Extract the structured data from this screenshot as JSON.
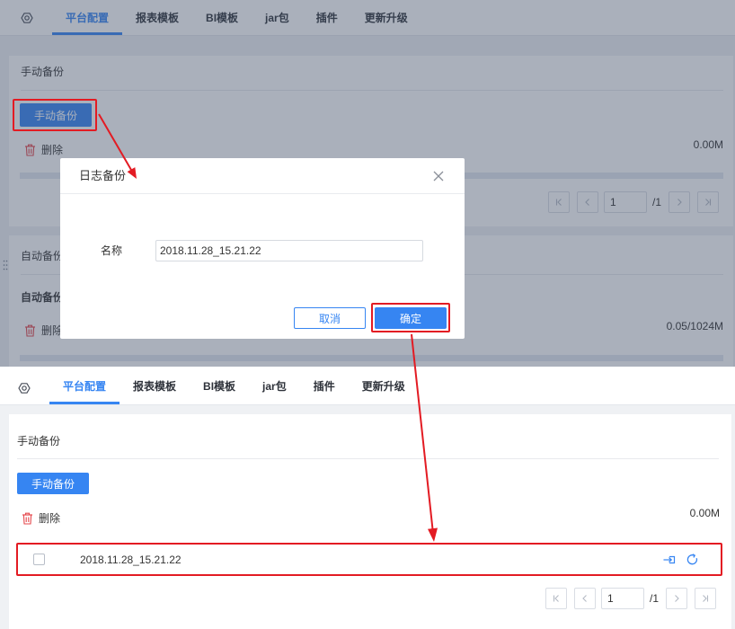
{
  "tabs": [
    {
      "label": "平台配置",
      "active": true
    },
    {
      "label": "报表模板",
      "active": false
    },
    {
      "label": "BI模板",
      "active": false
    },
    {
      "label": "jar包",
      "active": false
    },
    {
      "label": "插件",
      "active": false
    },
    {
      "label": "更新升级",
      "active": false
    }
  ],
  "before": {
    "manual_backup": {
      "section_title": "手动备份",
      "button_label": "手动备份",
      "delete_label": "删除",
      "storage_used": "0.00M",
      "rows": []
    },
    "pagination": {
      "current_page": "1",
      "total_label": "/1"
    },
    "auto_backup": {
      "section_title": "自动备份",
      "subsection_title": "自动备份",
      "delete_label": "删除",
      "storage_used": "0.05/1024M"
    }
  },
  "dialog": {
    "title": "日志备份",
    "name_label": "名称",
    "name_value": "2018.11.28_15.21.22",
    "cancel_label": "取消",
    "confirm_label": "确定"
  },
  "after": {
    "manual_backup": {
      "section_title": "手动备份",
      "button_label": "手动备份",
      "delete_label": "删除",
      "storage_used": "0.00M",
      "rows": [
        {
          "name": "2018.11.28_15.21.22",
          "checked": false
        }
      ]
    },
    "pagination": {
      "current_page": "1",
      "total_label": "/1"
    }
  },
  "icons": {
    "settings": "gear-icon",
    "delete": "trash-icon",
    "close": "close-icon",
    "first_page": "first-page-icon",
    "prev_page": "prev-page-icon",
    "next_page": "next-page-icon",
    "last_page": "last-page-icon",
    "row_restore": "restore-icon",
    "row_refresh": "refresh-icon",
    "resize": "drag-handle-icon"
  },
  "colors": {
    "accent": "#3685f2",
    "delete_icon": "#e5484d",
    "annotation": "#e31b23"
  }
}
